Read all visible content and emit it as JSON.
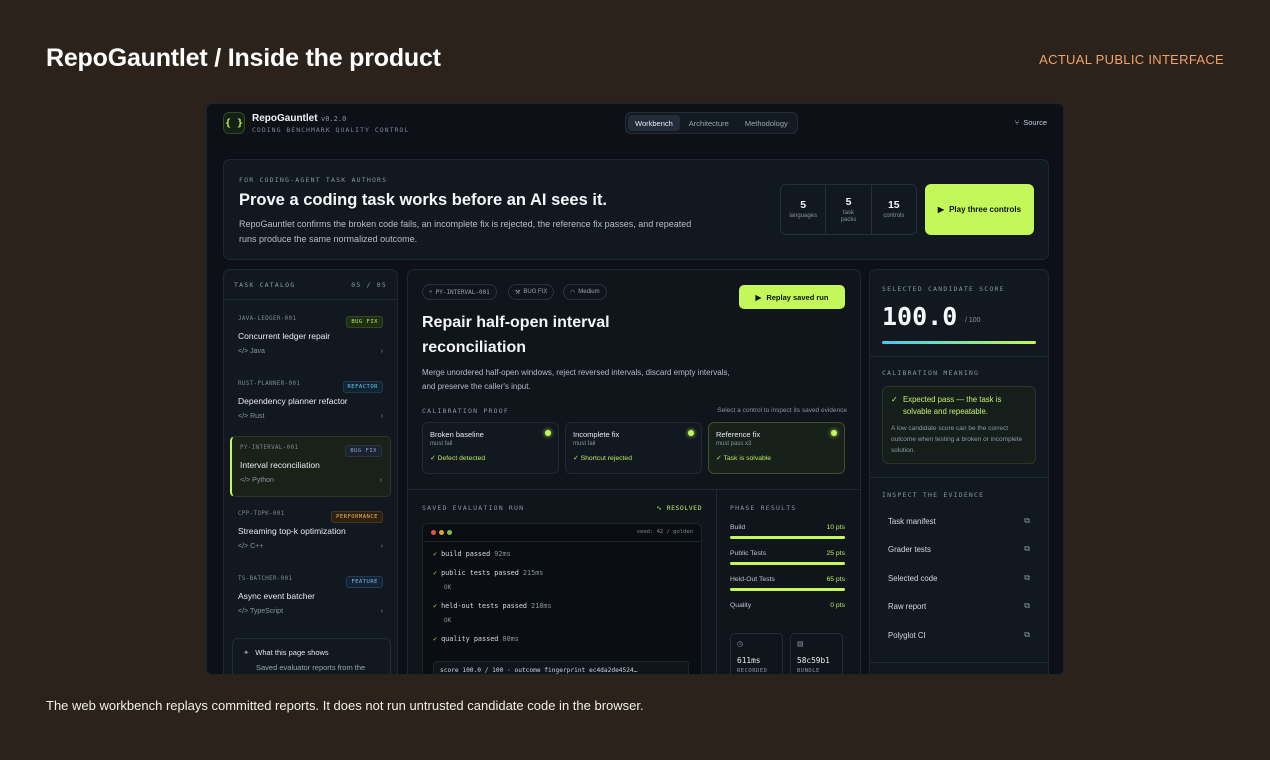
{
  "slide": {
    "title": "RepoGauntlet / Inside the product",
    "tag": "ACTUAL PUBLIC INTERFACE",
    "caption": "The web workbench replays committed reports. It does not run untrusted candidate code in the browser."
  },
  "app": {
    "logo": "{ }",
    "name": "RepoGauntlet",
    "version": "v0.2.0",
    "subtitle": "CODING BENCHMARK QUALITY CONTROL",
    "nav": [
      "Workbench",
      "Architecture",
      "Methodology"
    ],
    "nav_active": "Workbench",
    "source_label": "Source"
  },
  "hero": {
    "eyebrow": "FOR CODING-AGENT TASK AUTHORS",
    "title": "Prove a coding task works before an AI sees it.",
    "description": "RepoGauntlet confirms the broken code fails, an incomplete fix is rejected, the reference fix passes, and repeated runs produce the same normalized outcome.",
    "stats": [
      {
        "value": "5",
        "label": "languages"
      },
      {
        "value": "5",
        "label": "task packs"
      },
      {
        "value": "15",
        "label": "controls"
      }
    ],
    "play_label": "Play three controls"
  },
  "catalog": {
    "title": "TASK CATALOG",
    "count": "05 / 05",
    "tasks": [
      {
        "code": "JAVA-LEDGER-001",
        "badge": "BUG FIX",
        "name": "Concurrent ledger repair",
        "lang": "Java"
      },
      {
        "code": "RUST-PLANNER-001",
        "badge": "REFACTOR",
        "name": "Dependency planner refactor",
        "lang": "Rust"
      },
      {
        "code": "PY-INTERVAL-001",
        "badge": "BUG FIX",
        "name": "Interval reconciliation",
        "lang": "Python"
      },
      {
        "code": "CPP-TOPK-001",
        "badge": "PERFORMANCE",
        "name": "Streaming top-k optimization",
        "lang": "C++"
      },
      {
        "code": "TS-BATCHER-001",
        "badge": "FEATURE",
        "name": "Async event batcher",
        "lang": "TypeScript"
      }
    ],
    "info_title": "What this page shows",
    "info_sub": "Saved evaluator reports from the"
  },
  "detail": {
    "chips": [
      "PY-INTERVAL-001",
      "BUG FIX",
      "Medium"
    ],
    "replay_label": "Replay saved run",
    "title": "Repair half-open interval reconciliation",
    "description": "Merge unordered half-open windows, reject reversed intervals, discard empty intervals, and preserve the caller's input.",
    "calibration_title": "CALIBRATION PROOF",
    "calibration_hint": "Select a control to inspect its saved evidence",
    "controls": [
      {
        "name": "Broken baseline",
        "sub": "must fail",
        "result": "Defect detected"
      },
      {
        "name": "Incomplete fix",
        "sub": "must fail",
        "result": "Shortcut rejected"
      },
      {
        "name": "Reference fix",
        "sub": "must pass x3",
        "result": "Task is solvable"
      }
    ],
    "run_title": "SAVED EVALUATION RUN",
    "run_status": "RESOLVED",
    "seed": "seed: 42 / golden",
    "log": [
      {
        "text": "build passed",
        "ms": "92ms"
      },
      {
        "text": "public tests passed",
        "ms": "215ms",
        "ok": "OK"
      },
      {
        "text": "held-out tests passed",
        "ms": "218ms",
        "ok": "OK"
      },
      {
        "text": "quality passed",
        "ms": "80ms"
      }
    ],
    "score_line": "score 100.0 / 100 · outcome fingerprint ec4da2de4524…",
    "phase_title": "PHASE RESULTS",
    "phases": [
      {
        "name": "Build",
        "points": "10 pts",
        "fill": 1.0
      },
      {
        "name": "Public Tests",
        "points": "25 pts",
        "fill": 1.0
      },
      {
        "name": "Held-Out Tests",
        "points": "65 pts",
        "fill": 1.0
      },
      {
        "name": "Quality",
        "points": "0 pts",
        "fill": 0.0
      }
    ],
    "mini": [
      {
        "icon": "clock-icon",
        "glyph": "◷",
        "value": "611ms",
        "label": "RECORDED"
      },
      {
        "icon": "file-icon",
        "glyph": "▤",
        "value": "58c59b1",
        "label": "BUNDLE"
      }
    ]
  },
  "score": {
    "label": "SELECTED CANDIDATE SCORE",
    "value": "100.0",
    "out_of": "/ 100",
    "meaning_label": "CALIBRATION MEANING",
    "meaning_title": "Expected pass — the task is solvable and repeatable.",
    "meaning_sub": "A low candidate score can be the correct outcome when testing a broken or incomplete solution.",
    "evidence_label": "INSPECT THE EVIDENCE",
    "evidence": [
      "Task manifest",
      "Grader tests",
      "Selected code",
      "Raw report",
      "Polyglot CI"
    ]
  },
  "colors": {
    "accent": "#c4f75a",
    "background": "#0d1117",
    "slide_bg": "#2a221b",
    "tag": "#f0a46a"
  }
}
